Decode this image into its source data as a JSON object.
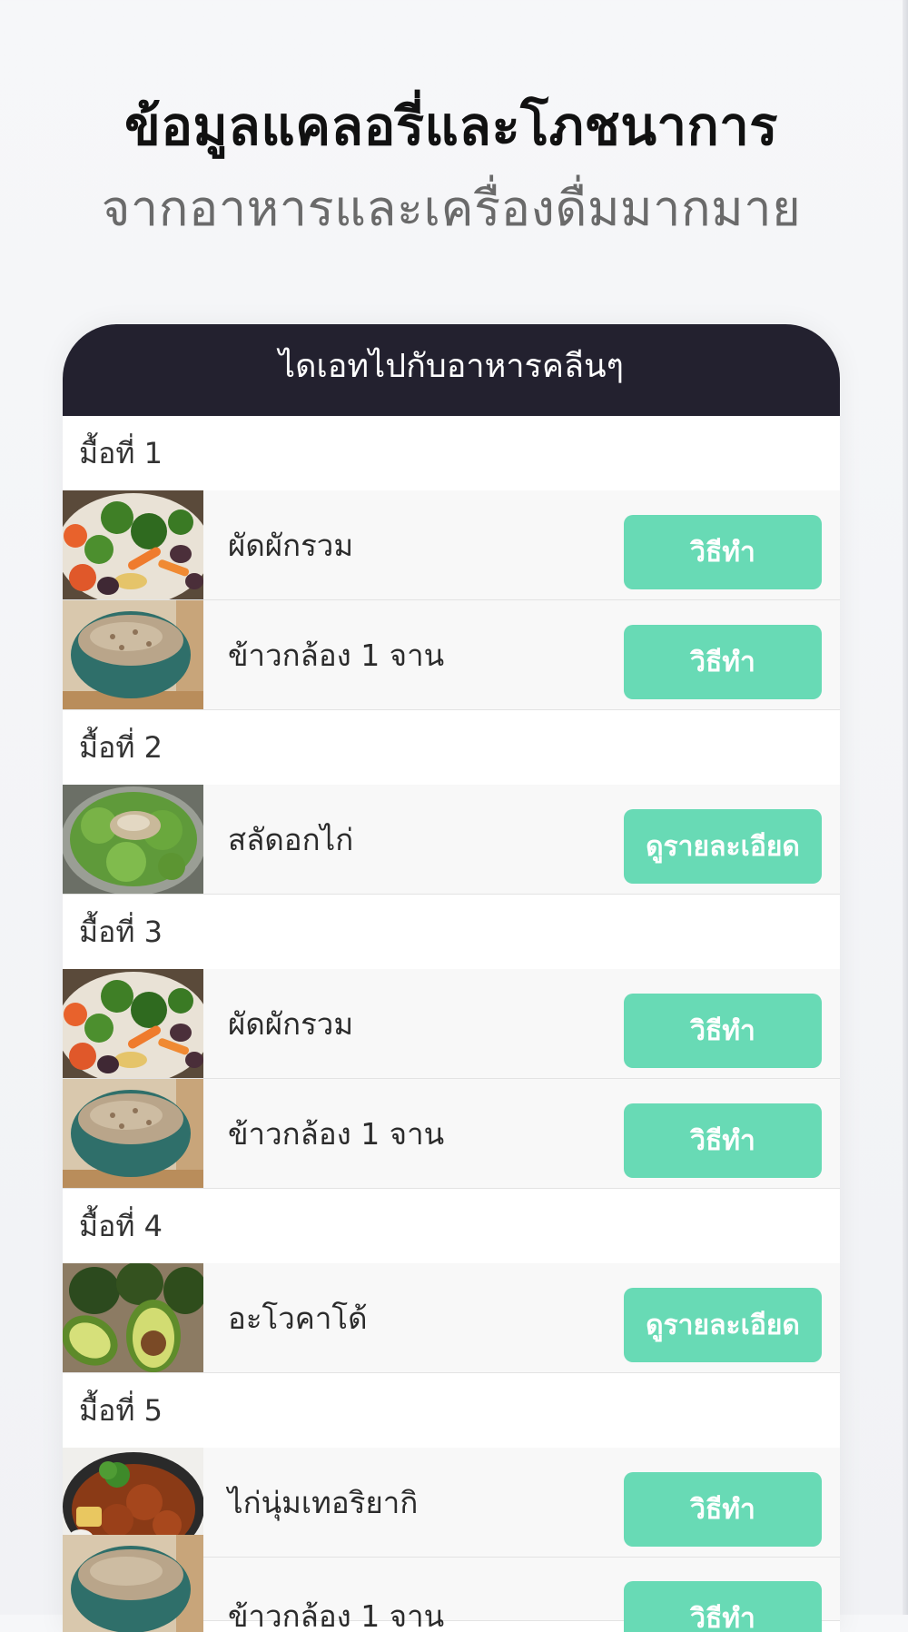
{
  "hero": {
    "title": "ข้อมูลแคลอรี่และโภชนาการ",
    "subtitle": "จากอาหารและเครื่องดื่มมากมาย"
  },
  "card": {
    "header": "ไดเอทไปกับอาหารคลีนๆ",
    "meals": [
      {
        "label": "มื้อที่ 1",
        "items": [
          {
            "name": "ผัดผักรวม",
            "action": "วิธีทำ",
            "image": "mixed-vegetables-photo"
          },
          {
            "name": "ข้าวกล้อง 1 จาน",
            "action": "วิธีทำ",
            "image": "brown-rice-bowl-photo"
          }
        ]
      },
      {
        "label": "มื้อที่ 2",
        "items": [
          {
            "name": "สลัดอกไก่",
            "action": "ดูรายละเอียด",
            "image": "chicken-salad-photo"
          }
        ]
      },
      {
        "label": "มื้อที่ 3",
        "items": [
          {
            "name": "ผัดผักรวม",
            "action": "วิธีทำ",
            "image": "mixed-vegetables-photo"
          },
          {
            "name": "ข้าวกล้อง 1 จาน",
            "action": "วิธีทำ",
            "image": "brown-rice-bowl-photo"
          }
        ]
      },
      {
        "label": "มื้อที่ 4",
        "items": [
          {
            "name": "อะโวคาโด้",
            "action": "ดูรายละเอียด",
            "image": "avocado-photo"
          }
        ]
      },
      {
        "label": "มื้อที่ 5",
        "items": [
          {
            "name": "ไก่นุ่มเทอริยากิ",
            "action": "วิธีทำ",
            "image": "teriyaki-chicken-photo"
          },
          {
            "name": "ข้าวกล้อง 1 จาน",
            "action": "วิธีทำ",
            "image": "brown-rice-bowl-photo"
          }
        ]
      }
    ]
  },
  "colors": {
    "header_bg": "#23212f",
    "button_bg": "#68dab5",
    "row_bg": "#f8f8f8"
  }
}
